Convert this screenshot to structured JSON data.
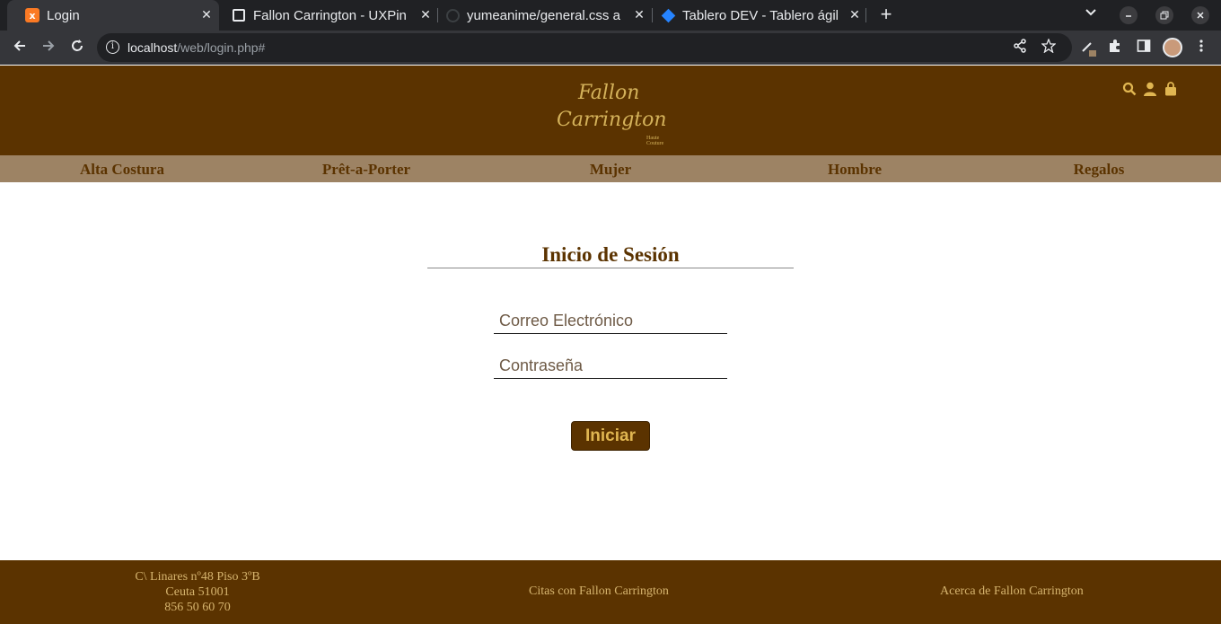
{
  "browser": {
    "tabs": [
      {
        "title": "Login",
        "favicon": "xampp-icon",
        "active": true
      },
      {
        "title": "Fallon Carrington - UXPin",
        "favicon": "page-icon",
        "active": false
      },
      {
        "title": "yumeanime/general.css a",
        "favicon": "github-icon",
        "active": false
      },
      {
        "title": "Tablero DEV - Tablero ágil",
        "favicon": "jira-icon",
        "active": false
      }
    ],
    "close_glyph": "✕",
    "newtab_glyph": "+",
    "url_host": "localhost",
    "url_path": "/web/login.php#"
  },
  "site": {
    "logo_line1": "Fallon",
    "logo_line2": "Carrington",
    "logo_tag": "Haute Couture",
    "nav": [
      "Alta Costura",
      "Prêt-a-Porter",
      "Mujer",
      "Hombre",
      "Regalos"
    ],
    "brand_color": "#5b3300",
    "nav_bg": "#9d8364",
    "accent": "#e0b651"
  },
  "login": {
    "title": "Inicio de Sesión",
    "email_placeholder": "Correo Electrónico",
    "password_placeholder": "Contraseña",
    "submit_label": "Iniciar"
  },
  "footer": {
    "address_line1": "C\\ Linares nº48 Piso 3ºB",
    "address_line2": "Ceuta 51001",
    "phone": "856 50 60 70",
    "link_citas": "Citas con Fallon Carrington",
    "link_acerca": "Acerca de Fallon Carrington"
  }
}
